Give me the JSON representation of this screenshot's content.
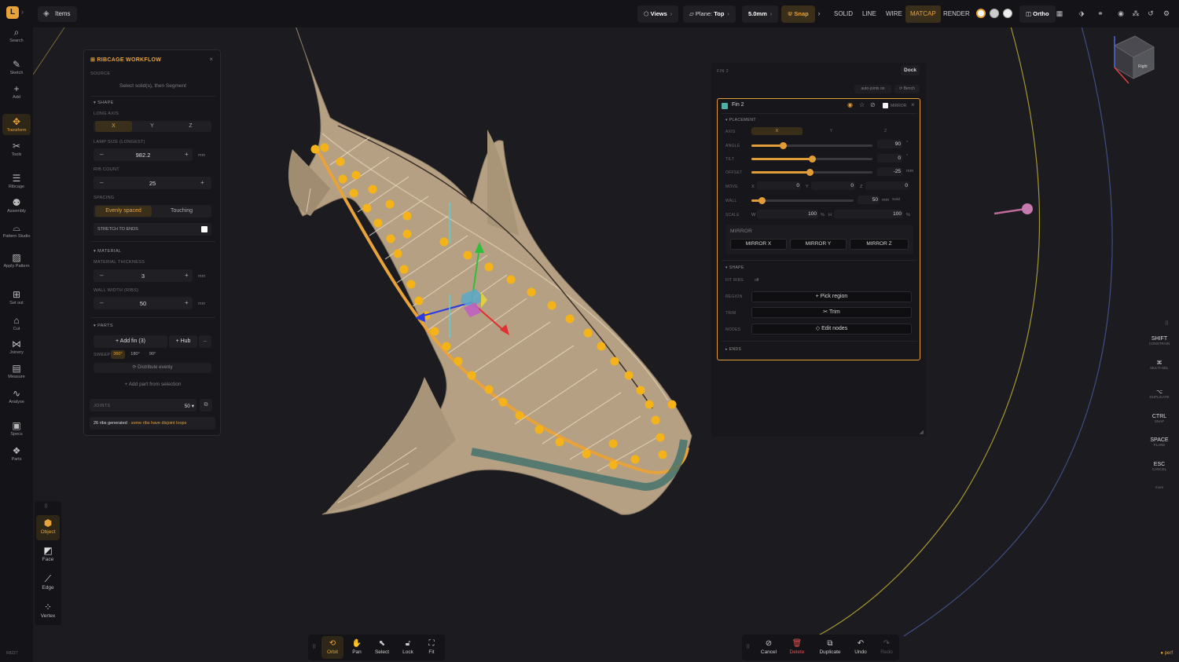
{
  "app": {
    "logo": "L",
    "items_label": "Items",
    "version": "R8227",
    "perf": "● perf"
  },
  "toolbar": {
    "views": "Views",
    "plane_label": "Plane:",
    "plane_value": "Top",
    "step": "5.0mm",
    "snap": "Snap",
    "modes": [
      "SOLID",
      "LINE",
      "WIRE",
      "MATCAP",
      "RENDER"
    ],
    "active_mode": "MATCAP",
    "ortho": "Ortho"
  },
  "left_sidebar": [
    {
      "label": "Search",
      "icon": "search-icon"
    },
    {
      "label": "Sketch",
      "icon": "pencil-icon"
    },
    {
      "label": "Add",
      "icon": "plus-icon"
    },
    {
      "label": "Transform",
      "icon": "move-icon",
      "active": true
    },
    {
      "label": "Tools",
      "icon": "tools-icon"
    },
    {
      "label": "Ribcage",
      "icon": "ribcage-icon"
    },
    {
      "label": "Assembly",
      "icon": "assembly-icon"
    },
    {
      "label": "Pattern Studio",
      "icon": "pattern-icon"
    },
    {
      "label": "Apply Pattern",
      "icon": "hatch-icon"
    },
    {
      "label": "Set out",
      "icon": "setout-icon"
    },
    {
      "label": "Cut",
      "icon": "cut-icon"
    },
    {
      "label": "Joinery",
      "icon": "joinery-icon"
    },
    {
      "label": "Measure",
      "icon": "measure-icon"
    },
    {
      "label": "Analyse",
      "icon": "analyse-icon"
    },
    {
      "label": "Specs",
      "icon": "specs-icon"
    },
    {
      "label": "Parts",
      "icon": "parts-icon"
    }
  ],
  "select_modes": [
    {
      "label": "Object",
      "active": true
    },
    {
      "label": "Face"
    },
    {
      "label": "Edge"
    },
    {
      "label": "Vertex"
    }
  ],
  "ribcage": {
    "title": "RIBCAGE WORKFLOW",
    "source_label": "SOURCE",
    "source_hint": "Select solid(s), then Segment",
    "shape_header": "SHAPE",
    "long_axis_label": "LONG AXIS",
    "axes": [
      "X",
      "Y",
      "Z"
    ],
    "lamp_size_label": "LAMP SIZE (LONGEST)",
    "lamp_size": "982.2",
    "unit": "mm",
    "rib_count_label": "RIB COUNT",
    "rib_count": "25",
    "spacing_label": "SPACING",
    "spacing_options": [
      "Evenly spaced",
      "Touching"
    ],
    "stretch_label": "STRETCH TO ENDS",
    "material_header": "MATERIAL",
    "thickness_label": "MATERIAL THICKNESS",
    "thickness": "3",
    "wall_label": "WALL WIDTH (RIBS)",
    "wall": "50",
    "parts_header": "PARTS",
    "add_fin": "+ Add fin (3)",
    "hub": "+ Hub",
    "sweep_label": "SWEEP",
    "sweep_options": [
      "360°",
      "180°",
      "90°"
    ],
    "distribute": "⟳ Distribute evenly",
    "add_part": "+ Add part from selection",
    "joints_label": "JOINTS",
    "joints_value": "50 ▾",
    "status_count": "26 ribs generated",
    "status_warn": " · some ribs have disjoint loops"
  },
  "fin": {
    "header": "FIN 2",
    "dock": "Dock",
    "auto_joints": "auto-joints on",
    "bench": "⟳ Bench",
    "name": "Fin 2",
    "mirror_label": "MIRROR",
    "placement": "PLACEMENT",
    "axis_label": "AXIS",
    "axes": [
      "X",
      "Y",
      "Z"
    ],
    "angle_label": "ANGLE",
    "angle": "90",
    "angle_pct": 0.26,
    "tilt_label": "TILT",
    "tilt": "0",
    "tilt_pct": 0.5,
    "offset_label": "OFFSET",
    "offset": "-25",
    "offset_pct": 0.48,
    "deg": "°",
    "mm": "mm",
    "move_label": "MOVE",
    "move_x_label": "X",
    "move_x": "0",
    "move_y_label": "Y",
    "move_y": "0",
    "move_z_label": "Z",
    "move_z": "0",
    "wall_label": "WALL",
    "wall": "50",
    "wall_pct": 0.1,
    "solid": "Solid",
    "scale_label": "SCALE",
    "w_label": "W",
    "w": "100",
    "h_label": "H",
    "h": "100",
    "pct": "%",
    "mirror_section": "MIRROR",
    "mirror_x": "MIRROR X",
    "mirror_y": "MIRROR Y",
    "mirror_z": "MIRROR Z",
    "shape_header": "SHAPE",
    "fit_ribs": "FIT RIBS",
    "fit_off": "off",
    "region_label": "REGION",
    "region_btn": "+ Pick region",
    "trim_label": "TRIM",
    "trim_btn": "✂ Trim",
    "nodes_label": "NODES",
    "nodes_btn": "◇ Edit nodes",
    "ends": "ENDS"
  },
  "shortcuts": [
    {
      "key": "SHIFT",
      "desc": "CONSTRAIN"
    },
    {
      "key": "⌘",
      "desc": "MULTI-SEL"
    },
    {
      "key": "⌥",
      "desc": "DUPLICATE"
    },
    {
      "key": "CTRL",
      "desc": "SNAP"
    },
    {
      "key": "SPACE",
      "desc": "PLANE"
    },
    {
      "key": "ESC",
      "desc": "CANCEL"
    }
  ],
  "shortcuts_more": "more",
  "viewcube_face": "Right",
  "nav": [
    {
      "label": "Orbit",
      "active": true
    },
    {
      "label": "Pan"
    },
    {
      "label": "Select"
    },
    {
      "label": "Lock"
    },
    {
      "label": "Fit"
    }
  ],
  "actions": [
    {
      "label": "Cancel"
    },
    {
      "label": "Delete"
    },
    {
      "label": "Duplicate"
    },
    {
      "label": "Undo"
    },
    {
      "label": "Redo",
      "disabled": true
    }
  ],
  "colors": {
    "accent": "#e8a23a",
    "bg": "#1b1b20",
    "panel": "#17171b",
    "shark": "#b5a084",
    "fin_swatch": "#4fb8a8"
  }
}
